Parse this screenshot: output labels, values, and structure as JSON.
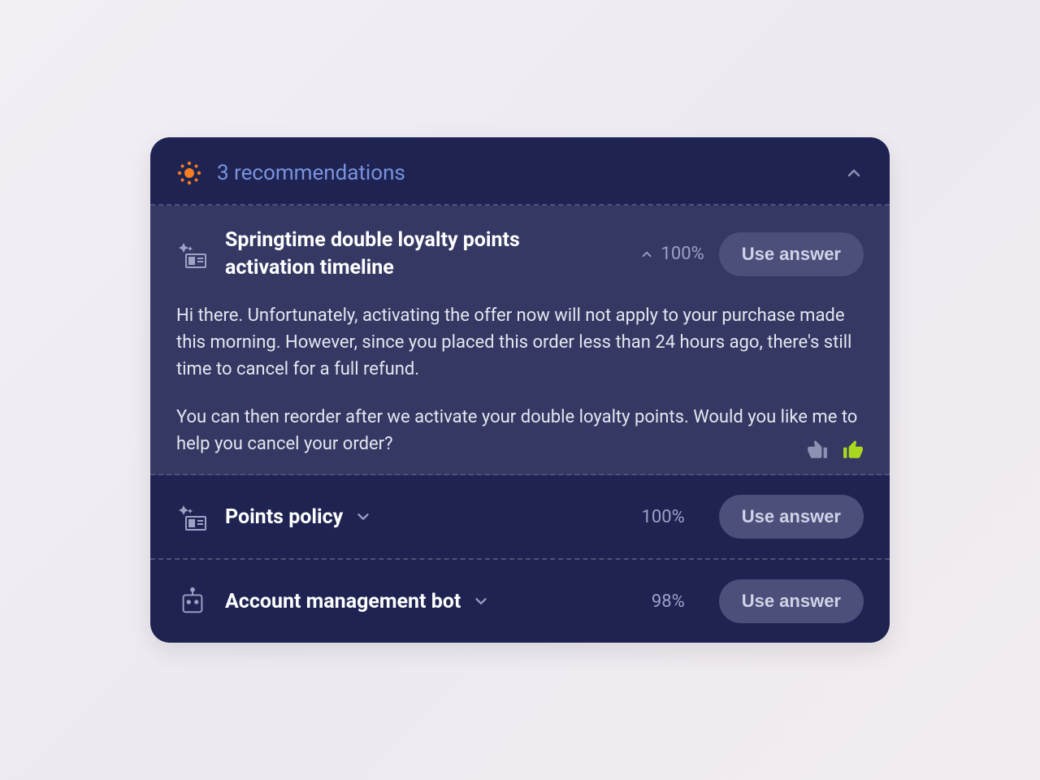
{
  "header": {
    "title": "3 recommendations"
  },
  "use_answer_label": "Use answer",
  "recommendations": [
    {
      "title": "Springtime double loyalty points activation timeline",
      "confidence": "100%",
      "body_p1": "Hi there. Unfortunately, activating the offer now will not apply to your purchase made this morning. However, since you placed this order less than 24 hours ago, there's still time to cancel for a full refund.",
      "body_p2": "You can then reorder after we activate your double loyalty points. Would you like me to help you cancel your order?"
    },
    {
      "title": "Points policy",
      "confidence": "100%"
    },
    {
      "title": "Account management bot",
      "confidence": "98%"
    }
  ]
}
